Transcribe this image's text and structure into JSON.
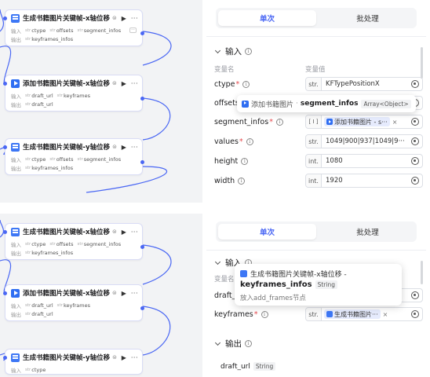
{
  "nodes": {
    "n1": {
      "title": "生成书籍图片关键帧-x轴位移",
      "badge": "⊜",
      "input_label": "输入",
      "output_label": "输出",
      "inputs": [
        {
          "type": "str",
          "name": "ctype"
        },
        {
          "type": "str",
          "name": "offsets"
        },
        {
          "type": "str",
          "name": "segment_infos"
        }
      ],
      "outputs": [
        {
          "type": "str",
          "name": "keyframes_infos"
        }
      ]
    },
    "n2": {
      "title": "添加书籍图片关键帧-x轴位移",
      "badge": "⊜",
      "input_label": "输入",
      "output_label": "输出",
      "inputs": [
        {
          "type": "str",
          "name": "draft_url"
        },
        {
          "type": "str",
          "name": "keyframes"
        }
      ],
      "outputs": [
        {
          "type": "str",
          "name": "draft_url"
        }
      ]
    },
    "n3": {
      "title": "生成书籍图片关键帧-y轴位移",
      "badge": "⊜",
      "input_label": "输入",
      "output_label": "输出",
      "inputs": [
        {
          "type": "str",
          "name": "ctype"
        },
        {
          "type": "str",
          "name": "offsets"
        },
        {
          "type": "str",
          "name": "segment_infos"
        }
      ],
      "outputs": [
        {
          "type": "str",
          "name": "keyframes_infos"
        }
      ]
    },
    "more_glyph": "···",
    "run_glyph": "▶"
  },
  "config": {
    "tab_single": "单次",
    "tab_batch": "批处理",
    "input_section": "输入",
    "output_section": "输出",
    "col_var_name": "变量名",
    "col_var_value": "变量值",
    "info_glyph": "i",
    "top_params": [
      {
        "name": "ctype",
        "type": "str.",
        "value": "KFTypePositionX"
      },
      {
        "name": "offsets",
        "type": "",
        "value": ""
      },
      {
        "name": "segment_infos",
        "type": "[ I ]",
        "value": "添加书籍图片 - s···"
      },
      {
        "name": "values",
        "type": "str.",
        "value": "1049|900|937|1049|9···"
      },
      {
        "name": "height",
        "type": "int.",
        "value": "1080"
      },
      {
        "name": "width",
        "type": "int.",
        "value": "1920"
      }
    ],
    "bottom_params": [
      {
        "name": "draft_",
        "type": "",
        "value": ""
      },
      {
        "name": "keyframes",
        "type": "str.",
        "value": "生成书籍图片···"
      }
    ],
    "bottom_col_partial": "变量名",
    "output_var": "draft_url",
    "output_var_type": "String",
    "close_glyph": "×"
  },
  "tooltip_top": {
    "source": "添加书籍图片",
    "dot": "·",
    "field": "segment_infos",
    "type": "Array<Object>"
  },
  "tooltip_bottom": {
    "source": "生成书籍图片关键帧-x轴位移 -",
    "field": "keyframes_infos",
    "type": "String",
    "hint": "放入add_frames节点"
  },
  "colors": {
    "accent": "#4a67f4",
    "required": "#e5484d",
    "canvas": "#f2f3f5"
  }
}
